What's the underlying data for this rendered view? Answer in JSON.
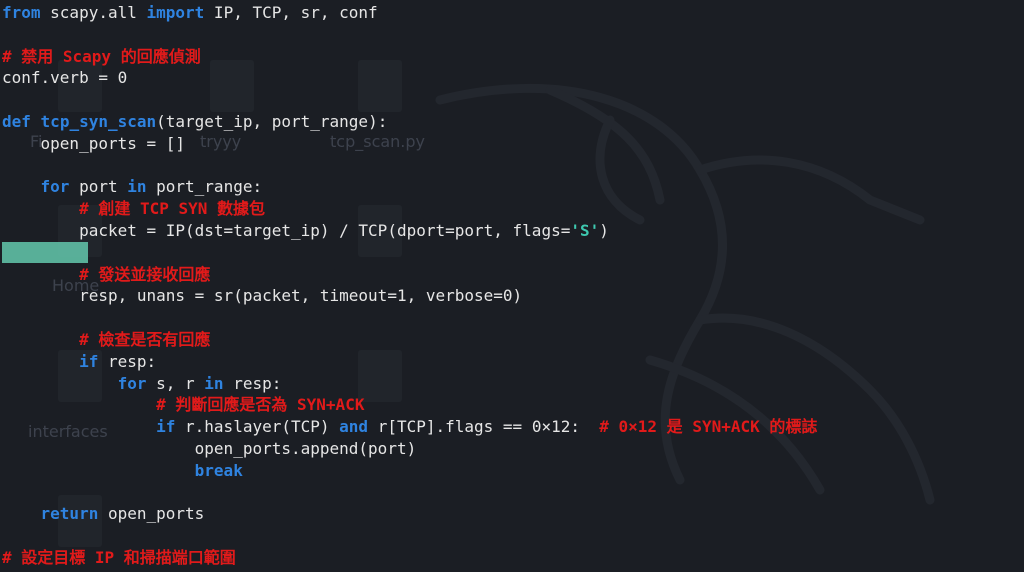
{
  "desktop": {
    "icon_labels": [
      "Fi",
      "tryyy",
      "tcp_scan.py",
      "Home",
      "interfaces"
    ]
  },
  "code": [
    {
      "segs": [
        {
          "t": "from",
          "c": "kw"
        },
        {
          "t": " scapy.all ",
          "c": ""
        },
        {
          "t": "import",
          "c": "kw"
        },
        {
          "t": " IP, TCP, sr, conf",
          "c": ""
        }
      ]
    },
    {
      "segs": []
    },
    {
      "segs": [
        {
          "t": "# 禁用 Scapy 的回應偵測",
          "c": "cm"
        }
      ]
    },
    {
      "segs": [
        {
          "t": "conf.verb = 0",
          "c": ""
        }
      ]
    },
    {
      "segs": []
    },
    {
      "segs": [
        {
          "t": "def",
          "c": "kw"
        },
        {
          "t": " ",
          "c": ""
        },
        {
          "t": "tcp_syn_scan",
          "c": "fn"
        },
        {
          "t": "(target_ip, port_range):",
          "c": ""
        }
      ]
    },
    {
      "segs": [
        {
          "t": "    open_ports = []",
          "c": ""
        }
      ]
    },
    {
      "segs": []
    },
    {
      "segs": [
        {
          "t": "    ",
          "c": ""
        },
        {
          "t": "for",
          "c": "kw"
        },
        {
          "t": " port ",
          "c": ""
        },
        {
          "t": "in",
          "c": "kw"
        },
        {
          "t": " port_range:",
          "c": ""
        }
      ]
    },
    {
      "segs": [
        {
          "t": "        ",
          "c": ""
        },
        {
          "t": "# 創建 TCP SYN 數據包",
          "c": "cm"
        }
      ]
    },
    {
      "segs": [
        {
          "t": "        packet = IP(dst=target_ip) / TCP(dport=port, flags=",
          "c": ""
        },
        {
          "t": "'S'",
          "c": "str"
        },
        {
          "t": ")",
          "c": ""
        }
      ]
    },
    {
      "segs": []
    },
    {
      "segs": [
        {
          "t": "        ",
          "c": ""
        },
        {
          "t": "# 發送並接收回應",
          "c": "cm"
        }
      ]
    },
    {
      "segs": [
        {
          "t": "        resp, unans = sr(packet, timeout=1, verbose=0)",
          "c": ""
        }
      ]
    },
    {
      "segs": []
    },
    {
      "segs": [
        {
          "t": "        ",
          "c": ""
        },
        {
          "t": "# 檢查是否有回應",
          "c": "cm"
        }
      ]
    },
    {
      "segs": [
        {
          "t": "        ",
          "c": ""
        },
        {
          "t": "if",
          "c": "kw"
        },
        {
          "t": " resp:",
          "c": ""
        }
      ]
    },
    {
      "segs": [
        {
          "t": "            ",
          "c": ""
        },
        {
          "t": "for",
          "c": "kw"
        },
        {
          "t": " s, r ",
          "c": ""
        },
        {
          "t": "in",
          "c": "kw"
        },
        {
          "t": " resp:",
          "c": ""
        }
      ]
    },
    {
      "segs": [
        {
          "t": "                ",
          "c": ""
        },
        {
          "t": "# 判斷回應是否為 SYN+ACK",
          "c": "cm"
        }
      ]
    },
    {
      "segs": [
        {
          "t": "                ",
          "c": ""
        },
        {
          "t": "if",
          "c": "kw"
        },
        {
          "t": " r.haslayer(TCP) ",
          "c": ""
        },
        {
          "t": "and",
          "c": "kw"
        },
        {
          "t": " r[TCP].flags == 0×12:  ",
          "c": ""
        },
        {
          "t": "# 0×12 是 SYN+ACK 的標誌",
          "c": "cm"
        }
      ]
    },
    {
      "segs": [
        {
          "t": "                    open_ports.append(port)",
          "c": ""
        }
      ]
    },
    {
      "segs": [
        {
          "t": "                    ",
          "c": ""
        },
        {
          "t": "break",
          "c": "kw"
        }
      ]
    },
    {
      "segs": []
    },
    {
      "segs": [
        {
          "t": "    ",
          "c": ""
        },
        {
          "t": "return",
          "c": "kw"
        },
        {
          "t": " open_ports",
          "c": ""
        }
      ]
    },
    {
      "segs": []
    },
    {
      "segs": [
        {
          "t": "# 設定目標 IP 和掃描端口範圍",
          "c": "cm"
        }
      ]
    }
  ]
}
